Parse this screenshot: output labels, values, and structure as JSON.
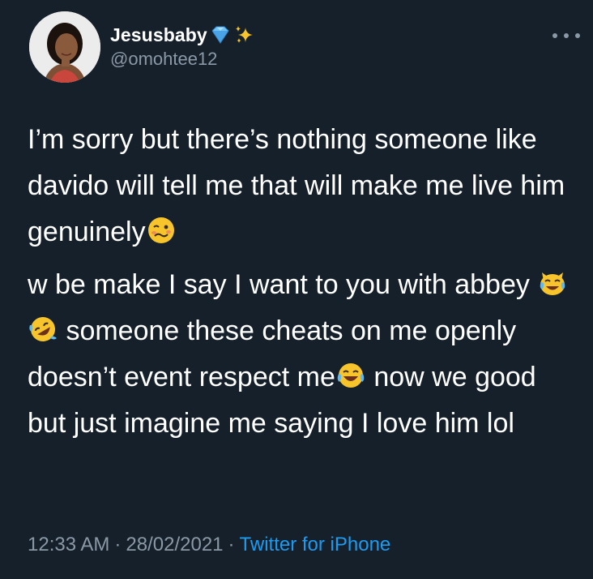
{
  "user": {
    "display_name": "Jesusbaby",
    "name_emojis": [
      "gem-stone-icon",
      "sparkles-icon"
    ],
    "handle": "@omohtee12"
  },
  "tweet": {
    "paragraphs": [
      {
        "segments": [
          {
            "type": "text",
            "value": "I’m sorry but there’s nothing someone like davido will tell me that will make me live him genuinely"
          },
          {
            "type": "emoji",
            "name": "woozy-face-icon"
          }
        ]
      },
      {
        "segments": [
          {
            "type": "text",
            "value": "w be make I say I want to you with abbey "
          },
          {
            "type": "emoji",
            "name": "cat-with-tears-of-joy-icon"
          },
          {
            "type": "text",
            "value": " "
          },
          {
            "type": "emoji",
            "name": "rolling-on-floor-laughing-icon"
          },
          {
            "type": "text",
            "value": " someone these cheats on me openly doesn’t event respect me"
          },
          {
            "type": "emoji",
            "name": "face-with-tears-of-joy-icon"
          },
          {
            "type": "text",
            "value": " now we good but just imagine me saying I love  him lol"
          }
        ]
      }
    ],
    "time": "12:33 AM",
    "date": "28/02/2021",
    "separator": "·",
    "source": "Twitter for iPhone"
  },
  "colors": {
    "background": "#15202b",
    "text": "#ffffff",
    "secondary_text": "#8b98a5",
    "link": "#1d9bf0"
  }
}
